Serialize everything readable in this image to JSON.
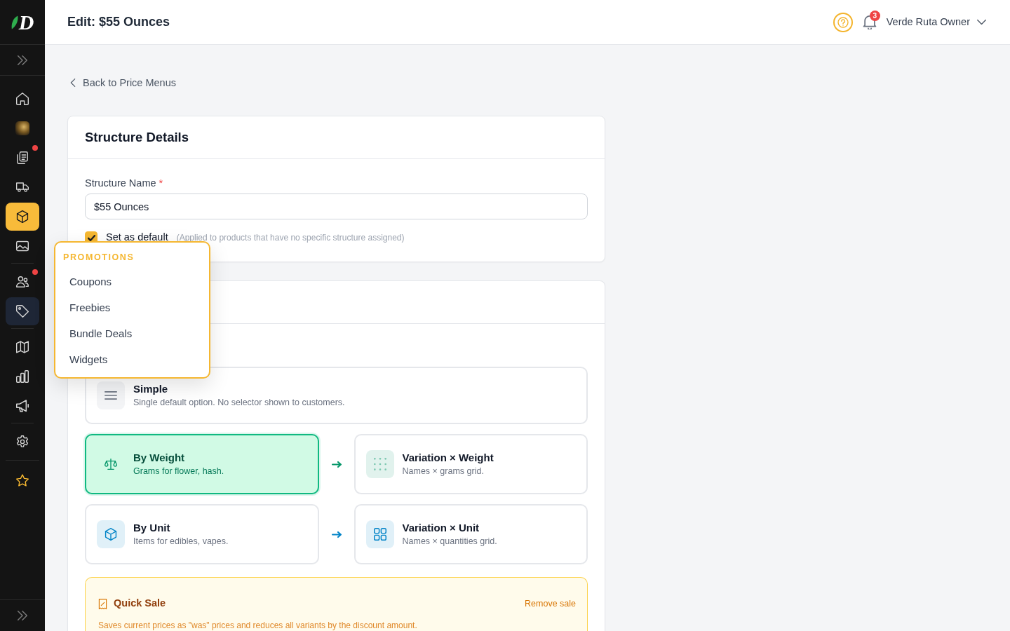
{
  "sidebar": {
    "logo": "D",
    "groups": [
      {
        "items": [
          {
            "kind": "icon",
            "selected": false,
            "open": false,
            "alert": false
          },
          {
            "kind": "photo",
            "selected": false,
            "open": false,
            "alert": false
          },
          {
            "kind": "icon",
            "selected": false,
            "open": false,
            "alert": true
          },
          {
            "kind": "icon",
            "selected": false,
            "open": false,
            "alert": false
          },
          {
            "kind": "icon",
            "selected": true,
            "open": false,
            "alert": false
          },
          {
            "kind": "icon",
            "selected": false,
            "open": false,
            "alert": false
          }
        ]
      },
      {
        "items": [
          {
            "kind": "icon",
            "selected": false,
            "open": false,
            "alert": true
          },
          {
            "kind": "icon",
            "selected": false,
            "open": true,
            "alert": false
          }
        ]
      },
      {
        "items": [
          {
            "kind": "icon",
            "selected": false,
            "open": false,
            "alert": false
          },
          {
            "kind": "icon",
            "selected": false,
            "open": false,
            "alert": false
          },
          {
            "kind": "icon",
            "selected": false,
            "open": false,
            "alert": false
          }
        ]
      },
      {
        "items": [
          {
            "kind": "icon",
            "selected": false,
            "open": false,
            "alert": false
          }
        ]
      },
      {
        "items": [
          {
            "kind": "icon",
            "selected": false,
            "open": false,
            "alert": false
          }
        ]
      }
    ],
    "flyout": {
      "title": "PROMOTIONS",
      "items": [
        "Coupons",
        "Freebies",
        "Bundle Deals",
        "Widgets"
      ]
    }
  },
  "header": {
    "title": "Edit: $55 Ounces",
    "notification_count": "3",
    "user": "Verde Ruta Owner"
  },
  "back_link": "Back to Price Menus",
  "structure_details": {
    "title": "Structure Details",
    "name_field": {
      "label": "Structure Name",
      "required_mark": "*",
      "value": "$55 Ounces"
    },
    "default_checkbox": {
      "label": "Set as default",
      "hint": "(Applied to products that have no specific structure assigned)",
      "checked": true
    }
  },
  "structure_type": {
    "simple": {
      "title": "Simple",
      "description": "Single default option. No selector shown to customers.",
      "selected": false
    },
    "pairs": [
      {
        "color": "#059669",
        "base": {
          "title": "By Weight",
          "description": "Grams for flower, hash.",
          "selected": true
        },
        "variation": {
          "title": "Variation × Weight",
          "description": "Names × grams grid.",
          "selected": false
        }
      },
      {
        "color": "#0284c7",
        "base": {
          "title": "By Unit",
          "description": "Items for edibles, vapes.",
          "selected": false
        },
        "variation": {
          "title": "Variation × Unit",
          "description": "Names × quantities grid.",
          "selected": false
        }
      }
    ],
    "quick_sale": {
      "title": "Quick Sale",
      "action": "Remove sale",
      "description": "Saves current prices as \"was\" prices and reduces all variants by the discount amount."
    }
  }
}
